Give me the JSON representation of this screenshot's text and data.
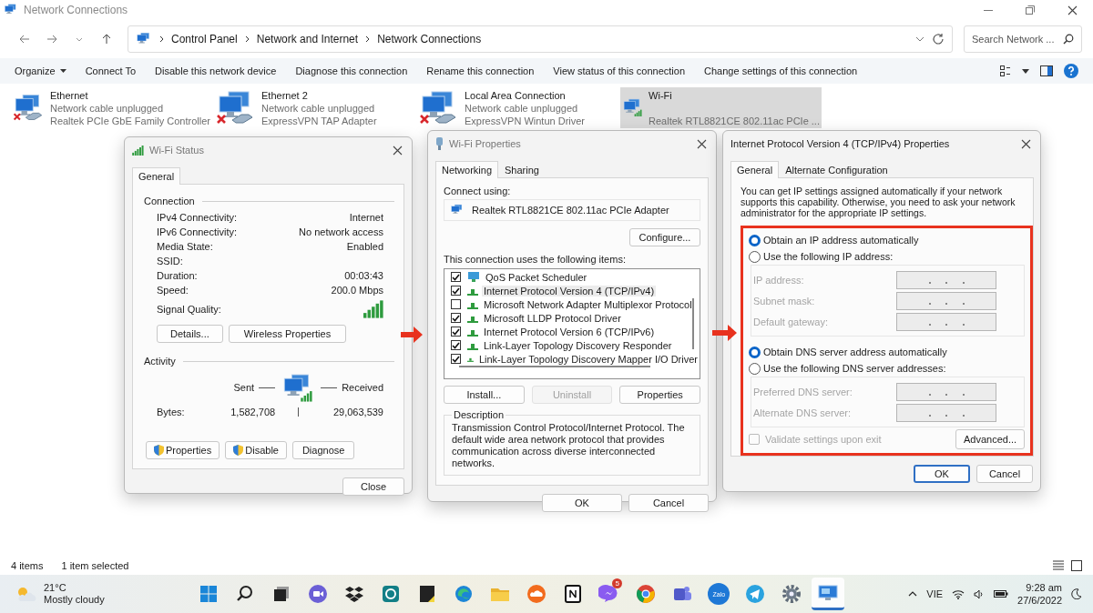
{
  "window": {
    "title": "Network Connections"
  },
  "address": {
    "crumbs": [
      "Control Panel",
      "Network and Internet",
      "Network Connections"
    ]
  },
  "search": {
    "placeholder": "Search Network ..."
  },
  "commands": [
    {
      "label": "Organize",
      "dropdown": true
    },
    {
      "label": "Connect To",
      "dropdown": false
    },
    {
      "label": "Disable this network device",
      "dropdown": false
    },
    {
      "label": "Diagnose this connection",
      "dropdown": false
    },
    {
      "label": "Rename this connection",
      "dropdown": false
    },
    {
      "label": "View status of this connection",
      "dropdown": false
    },
    {
      "label": "Change settings of this connection",
      "dropdown": false
    }
  ],
  "connections": [
    {
      "name": "Ethernet",
      "status": "Network cable unplugged",
      "adapter": "Realtek PCIe GbE Family Controller",
      "kind": "wired",
      "disconnected": true,
      "selected": false
    },
    {
      "name": "Ethernet 2",
      "status": "Network cable unplugged",
      "adapter": "ExpressVPN TAP Adapter",
      "kind": "wired",
      "disconnected": true,
      "selected": false
    },
    {
      "name": "Local Area Connection",
      "status": "Network cable unplugged",
      "adapter": "ExpressVPN Wintun Driver",
      "kind": "wired",
      "disconnected": true,
      "selected": false
    },
    {
      "name": "Wi-Fi",
      "adapter": "Realtek RTL8821CE 802.11ac PCIe ...",
      "kind": "wireless",
      "disconnected": false,
      "selected": true
    }
  ],
  "wifi_status": {
    "title": "Wi-Fi Status",
    "tabs": [
      {
        "label": "General",
        "selected": true
      }
    ],
    "connection_label": "Connection",
    "rows": [
      {
        "label": "IPv4 Connectivity:",
        "value": "Internet"
      },
      {
        "label": "IPv6 Connectivity:",
        "value": "No network access"
      },
      {
        "label": "Media State:",
        "value": "Enabled"
      },
      {
        "label": "SSID:"
      },
      {
        "label": "Duration:",
        "value": "00:03:43"
      },
      {
        "label": "Speed:",
        "value": "200.0 Mbps"
      }
    ],
    "signal_label": "Signal Quality:",
    "connection_buttons": [
      "Details...",
      "Wireless Properties"
    ],
    "activity_label": "Activity",
    "sent_label": "Sent",
    "received_label": "Received",
    "bytes_label": "Bytes:",
    "bytes_sent": "1,582,708",
    "bytes_received": "29,063,539",
    "buttons": [
      {
        "label": "Properties",
        "shield": true
      },
      {
        "label": "Disable",
        "shield": true
      },
      {
        "label": "Diagnose",
        "shield": false
      }
    ],
    "close": "Close"
  },
  "wifi_properties": {
    "title": "Wi-Fi Properties",
    "tabs": [
      {
        "label": "Networking",
        "selected": true
      },
      {
        "label": "Sharing",
        "selected": false
      }
    ],
    "connect_using_label": "Connect using:",
    "adapter": "Realtek RTL8821CE 802.11ac PCIe Adapter",
    "configure": "Configure...",
    "items_label": "This connection uses the following items:",
    "items": [
      {
        "label": "QoS Packet Scheduler",
        "kind": "service",
        "checked": true,
        "selected": false
      },
      {
        "label": "Internet Protocol Version 4 (TCP/IPv4)",
        "kind": "protocol",
        "checked": true,
        "selected": true
      },
      {
        "label": "Microsoft Network Adapter Multiplexor Protocol",
        "kind": "protocol",
        "checked": false,
        "selected": false
      },
      {
        "label": "Microsoft LLDP Protocol Driver",
        "kind": "protocol",
        "checked": true,
        "selected": false
      },
      {
        "label": "Internet Protocol Version 6 (TCP/IPv6)",
        "kind": "protocol",
        "checked": true,
        "selected": false
      },
      {
        "label": "Link-Layer Topology Discovery Responder",
        "kind": "protocol",
        "checked": true,
        "selected": false
      },
      {
        "label": "Link-Layer Topology Discovery Mapper I/O Driver",
        "kind": "protocol",
        "checked": true,
        "selected": false
      }
    ],
    "buttons": [
      {
        "label": "Install...",
        "disabled": false
      },
      {
        "label": "Uninstall",
        "disabled": true
      },
      {
        "label": "Properties",
        "disabled": false
      }
    ],
    "description_label": "Description",
    "description": "Transmission Control Protocol/Internet Protocol. The default wide area network protocol that provides communication across diverse interconnected networks.",
    "ok": "OK",
    "cancel": "Cancel"
  },
  "ipv4": {
    "title": "Internet Protocol Version 4 (TCP/IPv4) Properties",
    "tabs": [
      {
        "label": "General",
        "selected": true
      },
      {
        "label": "Alternate Configuration",
        "selected": false
      }
    ],
    "intro": "You can get IP settings assigned automatically if your network supports this capability. Otherwise, you need to ask your network administrator for the appropriate IP settings.",
    "ip_options": [
      {
        "label": "Obtain an IP address automatically",
        "selected": true
      },
      {
        "label": "Use the following IP address:",
        "selected": false
      }
    ],
    "ip_fields": [
      {
        "label": "IP address:",
        "disabled": true
      },
      {
        "label": "Subnet mask:",
        "disabled": true
      },
      {
        "label": "Default gateway:",
        "disabled": true
      }
    ],
    "dns_options": [
      {
        "label": "Obtain DNS server address automatically",
        "selected": true
      },
      {
        "label": "Use the following DNS server addresses:",
        "selected": false
      }
    ],
    "dns_fields": [
      {
        "label": "Preferred DNS server:",
        "disabled": true
      },
      {
        "label": "Alternate DNS server:",
        "disabled": true
      }
    ],
    "validate": {
      "label": "Validate settings upon exit",
      "checked": false,
      "disabled": true
    },
    "advanced": "Advanced...",
    "ok": "OK",
    "cancel": "Cancel"
  },
  "status_bar": {
    "item_count": "4 items",
    "selection": "1 item selected"
  },
  "taskbar": {
    "weather": {
      "temperature": "21°C",
      "condition": "Mostly cloudy"
    },
    "apps": [
      {
        "kind": "start",
        "selected": false
      },
      {
        "kind": "search",
        "selected": false
      },
      {
        "kind": "task-view",
        "selected": false
      },
      {
        "kind": "meet",
        "selected": false
      },
      {
        "kind": "dropbox",
        "selected": false
      },
      {
        "kind": "ring",
        "selected": false
      },
      {
        "kind": "note",
        "selected": false
      },
      {
        "kind": "edge",
        "selected": false
      },
      {
        "kind": "folder",
        "selected": false
      },
      {
        "kind": "cloud",
        "selected": false
      },
      {
        "kind": "square",
        "selected": false
      },
      {
        "kind": "messenger",
        "badge": "5",
        "selected": false
      },
      {
        "kind": "chrome",
        "selected": false
      },
      {
        "kind": "teams",
        "selected": false
      },
      {
        "kind": "zalo",
        "label": "Zalo",
        "selected": false
      },
      {
        "kind": "telegram",
        "selected": false
      },
      {
        "kind": "settings",
        "selected": false
      },
      {
        "kind": "network",
        "selected": true
      }
    ],
    "language": "VIE",
    "time": "9:28 am",
    "date": "27/6/2022"
  }
}
